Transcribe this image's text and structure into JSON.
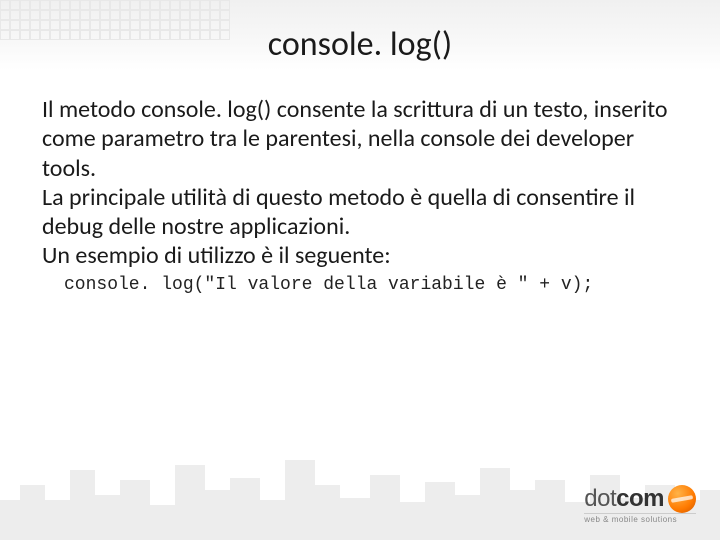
{
  "title": "console. log()",
  "paragraphs": [
    "Il metodo console. log() consente la scrittura di un testo, inserito come parametro tra le parentesi, nella console dei developer tools.",
    "La principale utilità di questo metodo è quella di consentire il debug delle nostre applicazioni.",
    "Un esempio di utilizzo è il seguente:"
  ],
  "code": "console. log(\"Il valore della variabile è \" + v);",
  "logo": {
    "brand_left": "dot",
    "brand_right": "com",
    "tagline": "web & mobile solutions"
  }
}
